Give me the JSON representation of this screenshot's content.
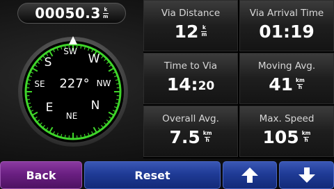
{
  "odometer": {
    "value": "00050.3",
    "unit_top": "k",
    "unit_bottom": "m"
  },
  "compass": {
    "heading": "227°",
    "labels": {
      "sw": "SW",
      "w": "W",
      "s": "S",
      "nw": "NW",
      "se": "SE",
      "n": "N",
      "e": "E",
      "ne": "NE"
    },
    "ring_color": "#3fd52a"
  },
  "fields": [
    {
      "label": "Via Distance",
      "value": "12",
      "unit_top": "k",
      "unit_bottom": "m"
    },
    {
      "label": "Via Arrival Time",
      "value": "01:19"
    },
    {
      "label": "Time to Via",
      "value_main": "14:",
      "value_small": "20"
    },
    {
      "label": "Moving Avg.",
      "value": "41",
      "unit_top": "km",
      "unit_bottom": "h"
    },
    {
      "label": "Overall Avg.",
      "value": "7.5",
      "unit_top": "km",
      "unit_bottom": "h"
    },
    {
      "label": "Max. Speed",
      "value": "105",
      "unit_top": "km",
      "unit_bottom": "h"
    }
  ],
  "buttons": {
    "back": "Back",
    "reset": "Reset",
    "up_icon": "arrow-up-icon",
    "down_icon": "arrow-down-icon"
  },
  "colors": {
    "back_button": "#6a1f82",
    "blue_button": "#1f3b96",
    "compass_ring": "#3fd52a"
  }
}
